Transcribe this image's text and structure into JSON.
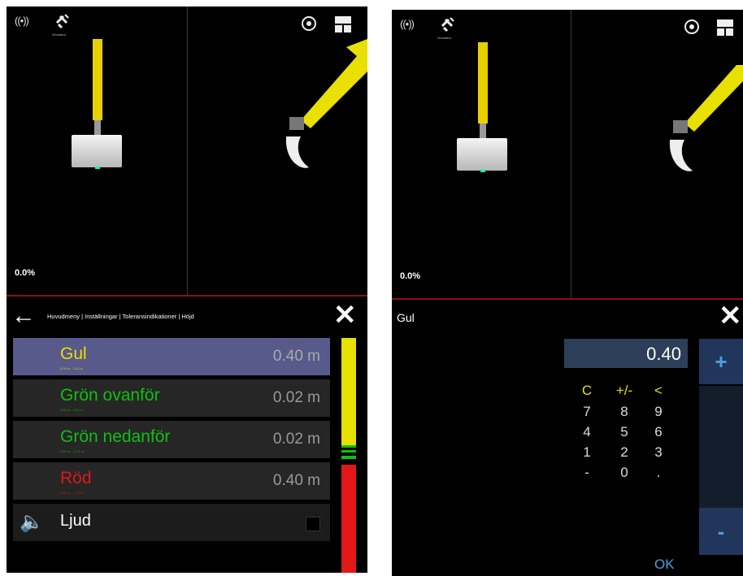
{
  "left_screen": {
    "slope_percent": "0.0%",
    "gps_label": "Simulator",
    "breadcrumb": "Huvudmeny | Inställningar | Toleransindikationer | Höjd",
    "rows": [
      {
        "label": "Gul",
        "value": "0.40 m",
        "sub": "0.00 m - 0.40 m",
        "color": "#e8e000"
      },
      {
        "label": "Grön ovanför",
        "value": "0.02 m",
        "sub": "0.00 m - 0.02 m",
        "color": "#10c010"
      },
      {
        "label": "Grön nedanför",
        "value": "0.02 m",
        "sub": "0.00 m - -0.02 m",
        "color": "#10c010"
      },
      {
        "label": "Röd",
        "value": "0.40 m",
        "sub": "0.40 m - -0.40 m",
        "color": "#e01818"
      }
    ],
    "sound_label": "Ljud"
  },
  "right_screen": {
    "slope_percent": "0.0%",
    "gps_label": "Simulator",
    "title": "Gul",
    "display_value": "0.40",
    "keypad": [
      [
        "C",
        "+/-",
        "<"
      ],
      [
        "7",
        "8",
        "9"
      ],
      [
        "4",
        "5",
        "6"
      ],
      [
        "1",
        "2",
        "3"
      ],
      [
        "-",
        "0",
        "."
      ]
    ],
    "plus_label": "+",
    "minus_label": "-",
    "ok_label": "OK"
  },
  "colors": {
    "yellow": "#e8d000",
    "green": "#10c010",
    "red": "#e01818",
    "selected_row": "#575a8a",
    "accent_blue": "#4a9fe0"
  }
}
